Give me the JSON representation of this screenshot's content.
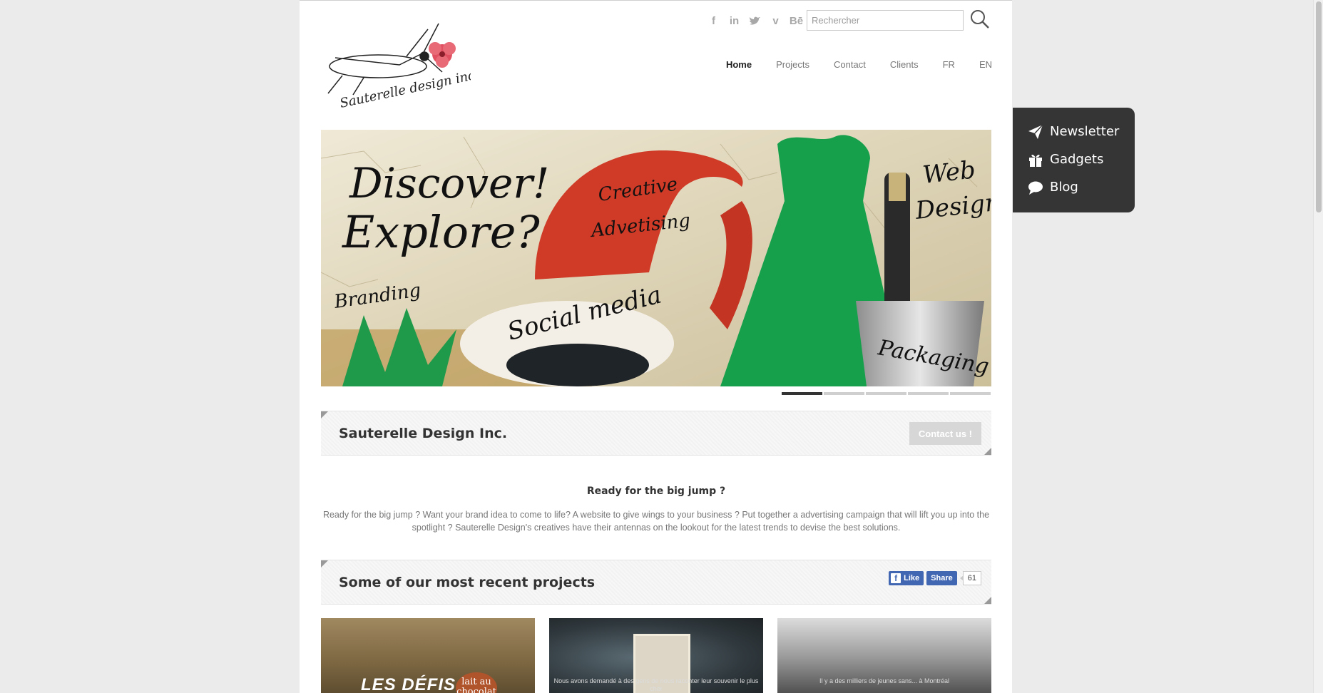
{
  "social_icons": [
    "facebook-icon",
    "linkedin-icon",
    "twitter-icon",
    "vimeo-icon",
    "behance-icon"
  ],
  "social_glyphs": {
    "facebook": "f",
    "linkedin": "in",
    "twitter": "🐦",
    "vimeo": "v",
    "behance": "Bē"
  },
  "search": {
    "placeholder": "Rechercher",
    "value": ""
  },
  "logo": {
    "text": "Sauterelle design inc."
  },
  "nav": {
    "home": "Home",
    "projects": "Projects",
    "contact": "Contact",
    "clients": "Clients",
    "fr": "FR",
    "en": "EN",
    "active": "Home"
  },
  "banner": {
    "headline1": "Discover!",
    "headline2": "Explore?",
    "creative": "Creative",
    "advetising": "Advetising",
    "branding": "Branding",
    "social": "Social media",
    "web": "Web",
    "design": "Design",
    "packaging": "Packaging",
    "slides": 5,
    "active_slide": 1
  },
  "company_box": {
    "title": "Sauterelle Design Inc.",
    "button": "Contact us !"
  },
  "intro": {
    "headline": "Ready for the big jump ?",
    "text": "Ready for the big jump ? Want your brand idea to come to life? A website to give wings to your business ? Put together a advertising campaign that will lift you up into the spotlight ? Sauterelle Design's creatives have their antennas on the lookout for the latest trends to devise the best solutions."
  },
  "projects_box": {
    "title": "Some of our most recent projects",
    "like": "Like",
    "share": "Share",
    "count": "61"
  },
  "thumbnails": [
    {
      "caption": "LES DÉFIS",
      "badge": "lait au chocolat"
    },
    {
      "caption": "Nous avons demandé à des gens de nous raconter leur souvenir le plus cher"
    },
    {
      "caption": "Il y a des milliers de jeunes sans... à Montréal"
    }
  ],
  "side_menu": {
    "newsletter": "Newsletter",
    "gadgets": "Gadgets",
    "blog": "Blog"
  },
  "colors": {
    "accent_dark": "#353535",
    "nav_active": "#222222",
    "nav": "#777777",
    "facebook": "#4267b2",
    "button": "#d7d7d7"
  }
}
